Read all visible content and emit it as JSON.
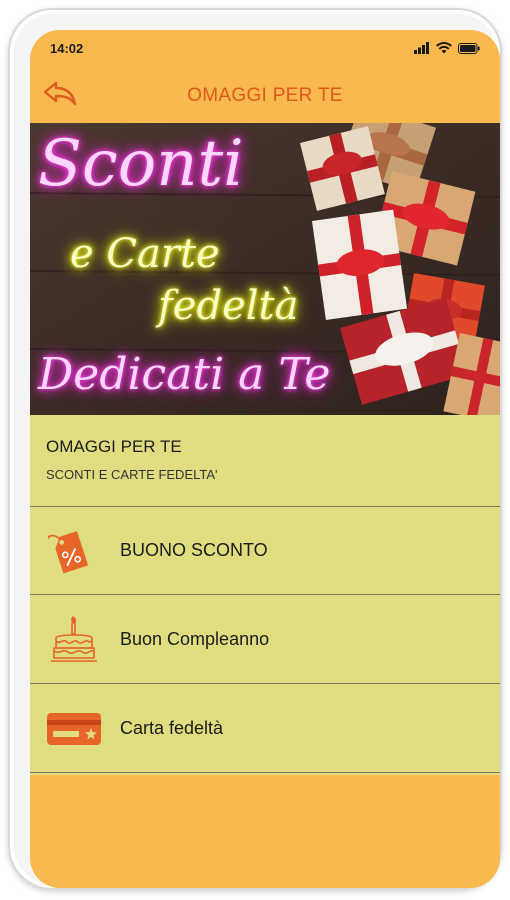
{
  "status": {
    "time": "14:02"
  },
  "appbar": {
    "title": "OMAGGI PER TE"
  },
  "banner": {
    "line1": "Sconti",
    "line2": "e Carte",
    "line3": "fedeltà",
    "line4": "Dedicati a Te"
  },
  "section": {
    "title": "OMAGGI PER TE",
    "subtitle": "SCONTI E CARTE FEDELTA'"
  },
  "items": [
    {
      "label": "BUONO SCONTO",
      "icon": "discount-tag-icon"
    },
    {
      "label": "Buon Compleanno",
      "icon": "birthday-cake-icon"
    },
    {
      "label": "Carta fedeltà",
      "icon": "loyalty-card-icon"
    }
  ],
  "colors": {
    "accent": "#e05a1c",
    "background": "#f9b94f",
    "list_background": "#dfdd80"
  }
}
